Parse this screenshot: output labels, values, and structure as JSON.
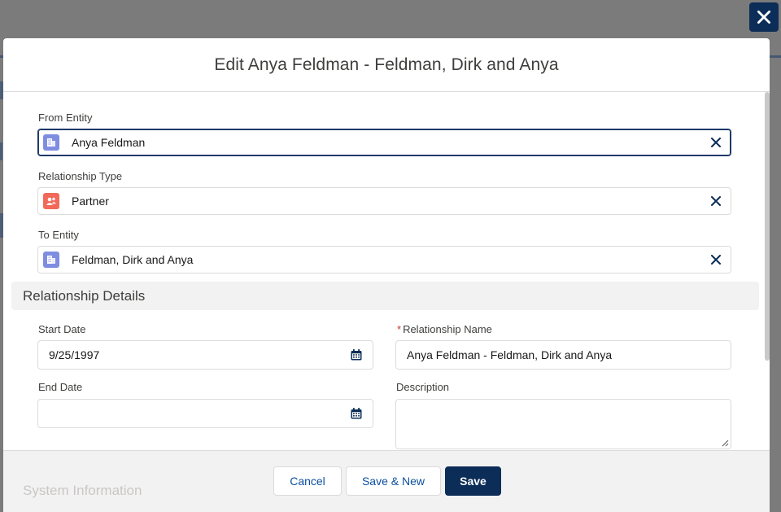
{
  "modal": {
    "title": "Edit Anya Feldman - Feldman, Dirk and Anya",
    "close_icon": "close-icon"
  },
  "fields": {
    "from_entity": {
      "label": "From Entity",
      "value": "Anya Feldman",
      "icon": "account-icon"
    },
    "relationship_type": {
      "label": "Relationship Type",
      "value": "Partner",
      "icon": "contact-icon"
    },
    "to_entity": {
      "label": "To Entity",
      "value": "Feldman, Dirk and Anya",
      "icon": "account-icon"
    }
  },
  "section": {
    "title": "Relationship Details"
  },
  "details": {
    "start_date": {
      "label": "Start Date",
      "value": "9/25/1997"
    },
    "end_date": {
      "label": "End Date",
      "value": ""
    },
    "relationship_name": {
      "required_marker": "*",
      "label": "Relationship Name",
      "value": "Anya Feldman - Feldman, Dirk and Anya"
    },
    "description": {
      "label": "Description",
      "value": ""
    }
  },
  "footer": {
    "background_section": "System Information",
    "cancel_label": "Cancel",
    "save_new_label": "Save & New",
    "save_label": "Save"
  },
  "colors": {
    "brand": "#0b2d58",
    "account_icon": "#7f8de1",
    "contact_icon": "#f2695a",
    "link": "#0b4fa0"
  }
}
